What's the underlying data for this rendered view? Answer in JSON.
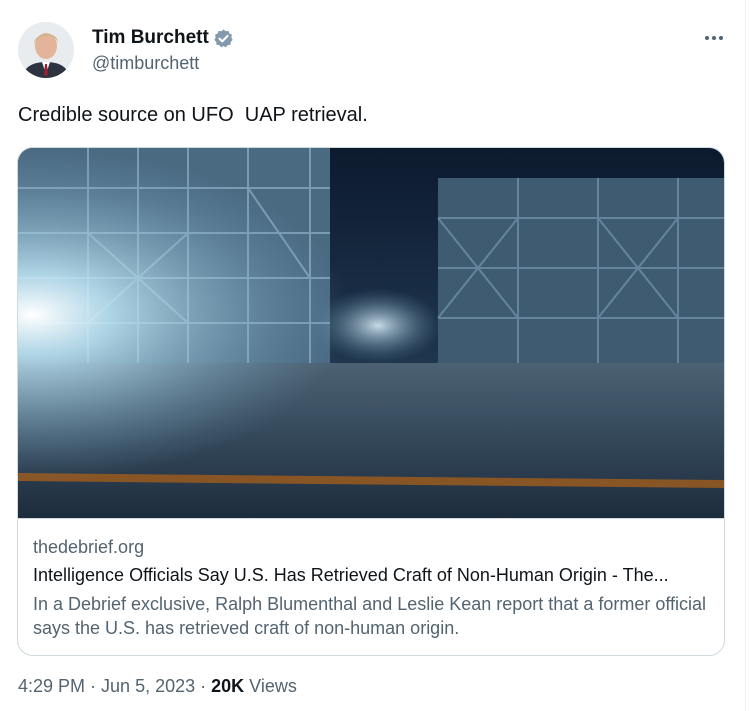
{
  "author": {
    "name": "Tim Burchett",
    "handle": "@timburchett",
    "verified_color": "#829aab"
  },
  "tweet": {
    "text": "Credible source on UFO  UAP retrieval."
  },
  "card": {
    "domain": "thedebrief.org",
    "title": "Intelligence Officials Say U.S. Has Retrieved Craft of Non-Human Origin - The...",
    "description": "In a Debrief exclusive, Ralph Blumenthal and Leslie Kean report that a former official says the U.S. has retrieved craft of non-human origin."
  },
  "meta": {
    "time": "4:29 PM",
    "sep1": " · ",
    "date": "Jun 5, 2023",
    "sep2": " · ",
    "views_count": "20K",
    "views_label": " Views"
  },
  "icons": {
    "verified": "verified-badge-icon",
    "more": "more-options-icon"
  }
}
